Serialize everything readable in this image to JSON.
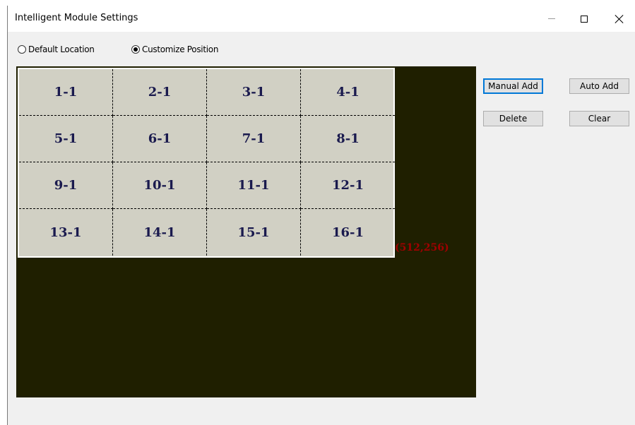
{
  "window": {
    "title": "Intelligent Module Settings"
  },
  "position_mode": {
    "options": [
      {
        "label": "Default Location",
        "selected": false
      },
      {
        "label": "Customize Position",
        "selected": true
      }
    ]
  },
  "canvas": {
    "background": "#1f1f00",
    "cell_color": "#d1d0c4",
    "label_color": "#1a1a4e",
    "coordinate_label": "(512,256)",
    "coordinate_color": "#a00000",
    "modules": [
      [
        "1-1",
        "2-1",
        "3-1",
        "4-1"
      ],
      [
        "5-1",
        "6-1",
        "7-1",
        "8-1"
      ],
      [
        "9-1",
        "10-1",
        "11-1",
        "12-1"
      ],
      [
        "13-1",
        "14-1",
        "15-1",
        "16-1"
      ]
    ]
  },
  "actions": {
    "manual_add": "Manual Add",
    "auto_add": "Auto Add",
    "delete": "Delete",
    "clear": "Clear"
  }
}
